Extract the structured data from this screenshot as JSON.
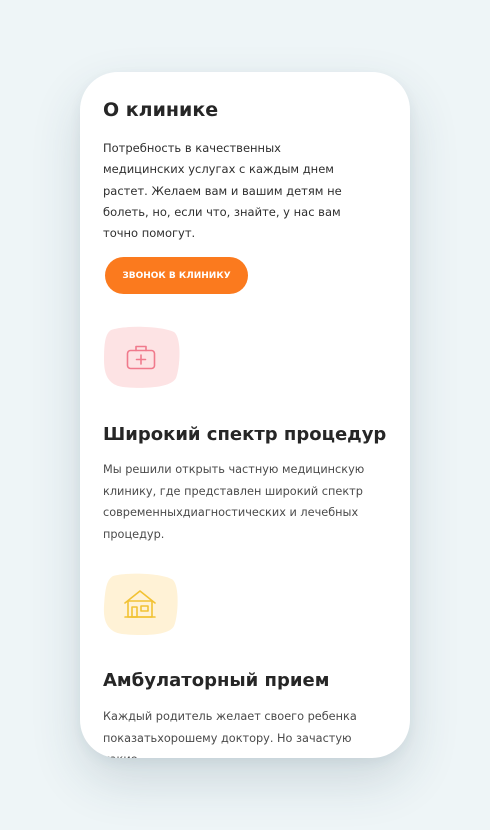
{
  "about": {
    "title": "О клинике",
    "text": "Потребность в качественных медицинских услугах с каждым днем растет. Желаем вам и вашим детям не болеть, но, если что, знайте, у нас вам точно помогут.",
    "button_label": "ЗВОНОК В КЛИНИКУ"
  },
  "features": [
    {
      "icon": "medical-kit-icon",
      "icon_color": "#f07a8c",
      "blob_color": "#fde3e4",
      "title": "Широкий спектр процедур",
      "text": "Мы решили открыть частную медицинскую клинику, где представлен широкий спектр современныхдиагностических и лечебных процедур."
    },
    {
      "icon": "house-icon",
      "icon_color": "#f2c233",
      "blob_color": "#fff2d6",
      "title": "Амбулаторный прием",
      "text": "Каждый родитель желает своего ребенка показатьхорошему доктору. Но зачастую такие"
    }
  ],
  "colors": {
    "accent": "#fb7a1e",
    "background": "#eef5f7"
  }
}
